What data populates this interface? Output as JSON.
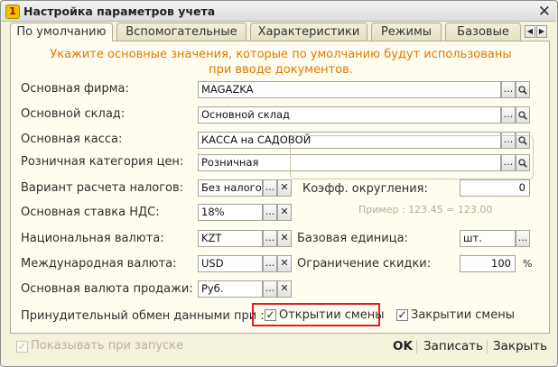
{
  "window": {
    "title": "Настройка параметров учета",
    "close_glyph": "✕"
  },
  "tabs": [
    {
      "label": "По умолчанию",
      "active": true
    },
    {
      "label": "Вспомогательные"
    },
    {
      "label": "Характеристики"
    },
    {
      "label": "Режимы"
    },
    {
      "label": "Базовые"
    }
  ],
  "tab_nav": {
    "prev": "◀",
    "next": "▶"
  },
  "hint": {
    "line1": "Укажите основные значения, которые по умолчанию будут использованы",
    "line2": "при вводе документов."
  },
  "fields": {
    "company": {
      "label": "Основная фирма:",
      "value": "MAGAZKA"
    },
    "warehouse": {
      "label": "Основной склад:",
      "value": "Основной склад"
    },
    "cash": {
      "label": "Основная касса:",
      "value": "КАССА на САДОВОЙ"
    },
    "price_category": {
      "label": "Розничная категория цен:",
      "value": "Розничная"
    },
    "tax_option": {
      "label": "Вариант расчета налогов:",
      "value": "Без налогов"
    },
    "vat_rate": {
      "label": "Основная ставка НДС:",
      "value": "18%"
    },
    "national_currency": {
      "label": "Национальная валюта:",
      "value": "KZT"
    },
    "intl_currency": {
      "label": "Международная валюта:",
      "value": "USD"
    },
    "sales_currency": {
      "label": "Основная валюта продажи:",
      "value": "Руб."
    },
    "rounding": {
      "label": "Коэфф. округления:",
      "value": "0",
      "example": "Пример : 123.45 = 123.00"
    },
    "base_unit": {
      "label": "Базовая единица:",
      "value": "шт."
    },
    "discount_limit": {
      "label": "Ограничение скидки:",
      "value": "100",
      "unit": "%"
    }
  },
  "exchange": {
    "label": "Принудительный обмен данными  при :",
    "on_open": {
      "label": "Открытии смены",
      "checked": true
    },
    "on_close": {
      "label": "Закрытии смены",
      "checked": true
    }
  },
  "footer": {
    "show_on_start": {
      "label": "Показывать при запуске",
      "checked": true,
      "enabled": false
    },
    "ok": "OK",
    "save": "Записать",
    "close": "Закрыть"
  },
  "glyphs": {
    "ellipsis": "...",
    "clear": "✕",
    "check": "✓",
    "search_icon": "magnifier"
  },
  "colors": {
    "hint": "#e07a00",
    "highlight": "#e0201c",
    "panel": "#fffdf0"
  }
}
